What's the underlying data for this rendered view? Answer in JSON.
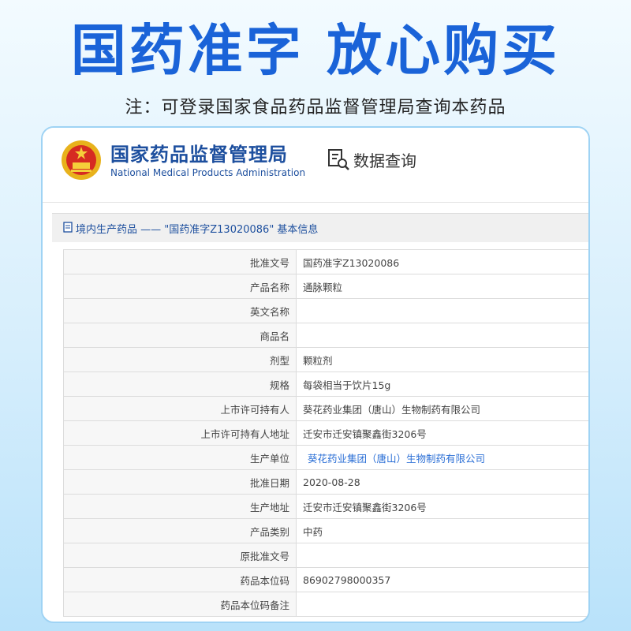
{
  "banner": {
    "headline": "国药准字  放心购买",
    "note": "注：可登录国家食品药品监督管理局查询本药品"
  },
  "site": {
    "name_cn": "国家药品监督管理局",
    "name_en": "National Medical Products Administration",
    "query_label": "数据查询"
  },
  "section": {
    "title": "境内生产药品 —— \"国药准字Z13020086\" 基本信息"
  },
  "rows": [
    {
      "label": "批准文号",
      "value": "国药准字Z13020086"
    },
    {
      "label": "产品名称",
      "value": "通脉颗粒"
    },
    {
      "label": "英文名称",
      "value": ""
    },
    {
      "label": "商品名",
      "value": ""
    },
    {
      "label": "剂型",
      "value": "颗粒剂"
    },
    {
      "label": "规格",
      "value": "每袋相当于饮片15g"
    },
    {
      "label": "上市许可持有人",
      "value": "葵花药业集团（唐山）生物制药有限公司"
    },
    {
      "label": "上市许可持有人地址",
      "value": "迁安市迁安镇聚鑫街3206号"
    },
    {
      "label": "生产单位",
      "value": "葵花药业集团（唐山）生物制药有限公司"
    },
    {
      "label": "批准日期",
      "value": "2020-08-28"
    },
    {
      "label": "生产地址",
      "value": "迁安市迁安镇聚鑫街3206号"
    },
    {
      "label": "产品类别",
      "value": "中药"
    },
    {
      "label": "原批准文号",
      "value": ""
    },
    {
      "label": "药品本位码",
      "value": "86902798000357"
    },
    {
      "label": "药品本位码备注",
      "value": ""
    }
  ],
  "icons": {
    "emblem": "national-emblem-icon",
    "query": "document-search-icon",
    "section": "document-icon"
  },
  "colors": {
    "headline": "#1a63d8",
    "org": "#1d4f9e",
    "link": "#2b6fd6"
  }
}
